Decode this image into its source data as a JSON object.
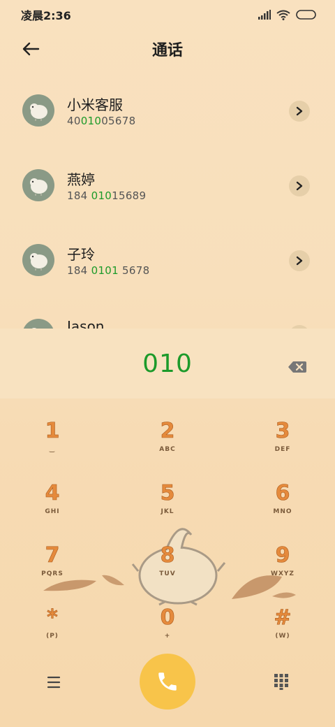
{
  "status": {
    "time": "凌晨2:36"
  },
  "header": {
    "title": "通话"
  },
  "contacts": [
    {
      "name": "小米客服",
      "num_pre": "40",
      "num_hl": "010",
      "num_post": "05678"
    },
    {
      "name": "燕婷",
      "num_pre": "184 ",
      "num_hl": "010",
      "num_post": "15689"
    },
    {
      "name": "子玲",
      "num_pre": "184 ",
      "num_hl": "0101",
      "num_post": " 5678"
    },
    {
      "name": "Jason",
      "num_pre": "",
      "num_hl": "",
      "num_post": ""
    }
  ],
  "dial": {
    "number": "010"
  },
  "keypad": [
    {
      "digit": "1",
      "letters": ""
    },
    {
      "digit": "2",
      "letters": "ABC"
    },
    {
      "digit": "3",
      "letters": "DEF"
    },
    {
      "digit": "4",
      "letters": "GHI"
    },
    {
      "digit": "5",
      "letters": "JKL"
    },
    {
      "digit": "6",
      "letters": "MNO"
    },
    {
      "digit": "7",
      "letters": "PQRS"
    },
    {
      "digit": "8",
      "letters": "TUV"
    },
    {
      "digit": "9",
      "letters": "WXYZ"
    },
    {
      "digit": "*",
      "letters": "(P)"
    },
    {
      "digit": "0",
      "letters": "+"
    },
    {
      "digit": "#",
      "letters": "(W)"
    }
  ],
  "colors": {
    "match": "#1c9a2a",
    "call": "#f8c44a",
    "digit": "#e58a3c"
  },
  "icons": {
    "back": "arrow-left-icon",
    "detail": "chevron-right-icon",
    "backspace": "backspace-icon",
    "menu": "menu-icon",
    "call": "phone-icon",
    "dialpad": "dialpad-icon"
  }
}
